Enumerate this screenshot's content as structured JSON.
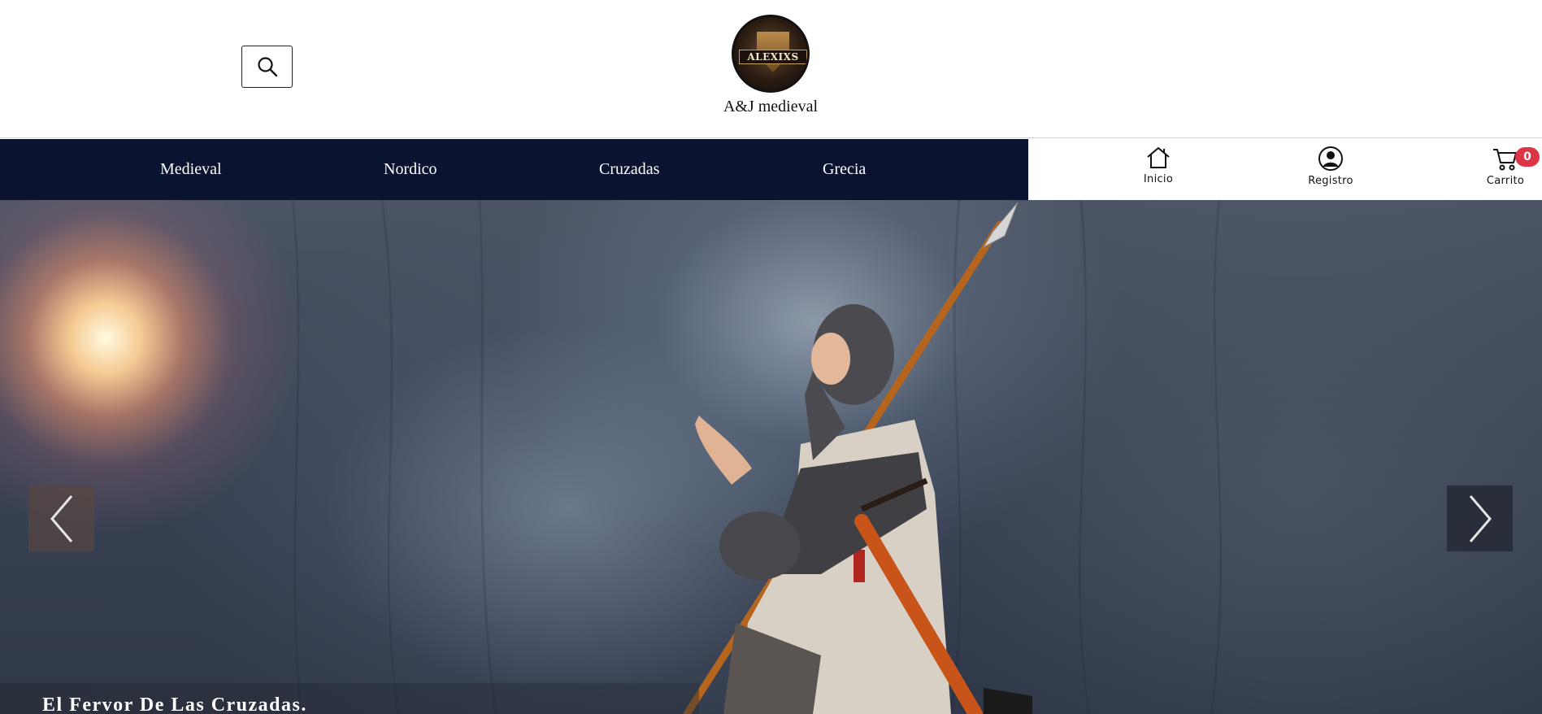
{
  "header": {
    "brand_name": "A&J medieval",
    "logo_text": "ALEXIXS",
    "search_icon": "search-icon"
  },
  "nav": {
    "items": [
      {
        "label": "Medieval"
      },
      {
        "label": "Nordico"
      },
      {
        "label": "Cruzadas"
      },
      {
        "label": "Grecia"
      }
    ],
    "background": "#0a1430"
  },
  "utility": {
    "items": [
      {
        "label": "Inicio",
        "icon": "home-icon"
      },
      {
        "label": "Registro",
        "icon": "user-circle-icon"
      },
      {
        "label": "Carrito",
        "icon": "cart-icon"
      }
    ],
    "cart_count": "0",
    "badge_color": "#dc3545"
  },
  "hero": {
    "caption": "El Fervor De Las Cruzadas.",
    "prev_icon": "chevron-left-icon",
    "next_icon": "chevron-right-icon"
  }
}
